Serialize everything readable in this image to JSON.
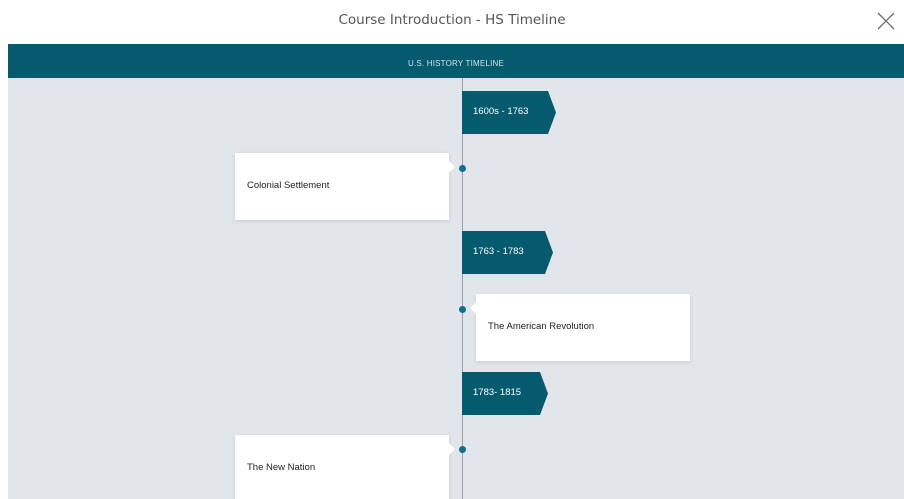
{
  "modal": {
    "title": "Course Introduction - HS Timeline",
    "close_icon": "close-icon"
  },
  "banner": {
    "title": "U.S. HISTORY TIMELINE"
  },
  "colors": {
    "banner": "#055a6d",
    "flag": "#055a6d",
    "dot": "#0e6f91",
    "background": "#e1e6ea",
    "axis": "#9aa3ab"
  },
  "timeline": {
    "eras": [
      {
        "label": "1600s - 1763"
      },
      {
        "label": "1763 - 1783"
      },
      {
        "label": "1783- 1815"
      }
    ],
    "events": [
      {
        "label": "Colonial Settlement",
        "side": "left"
      },
      {
        "label": "The American Revolution",
        "side": "right"
      },
      {
        "label": "The New Nation",
        "side": "left"
      }
    ]
  }
}
